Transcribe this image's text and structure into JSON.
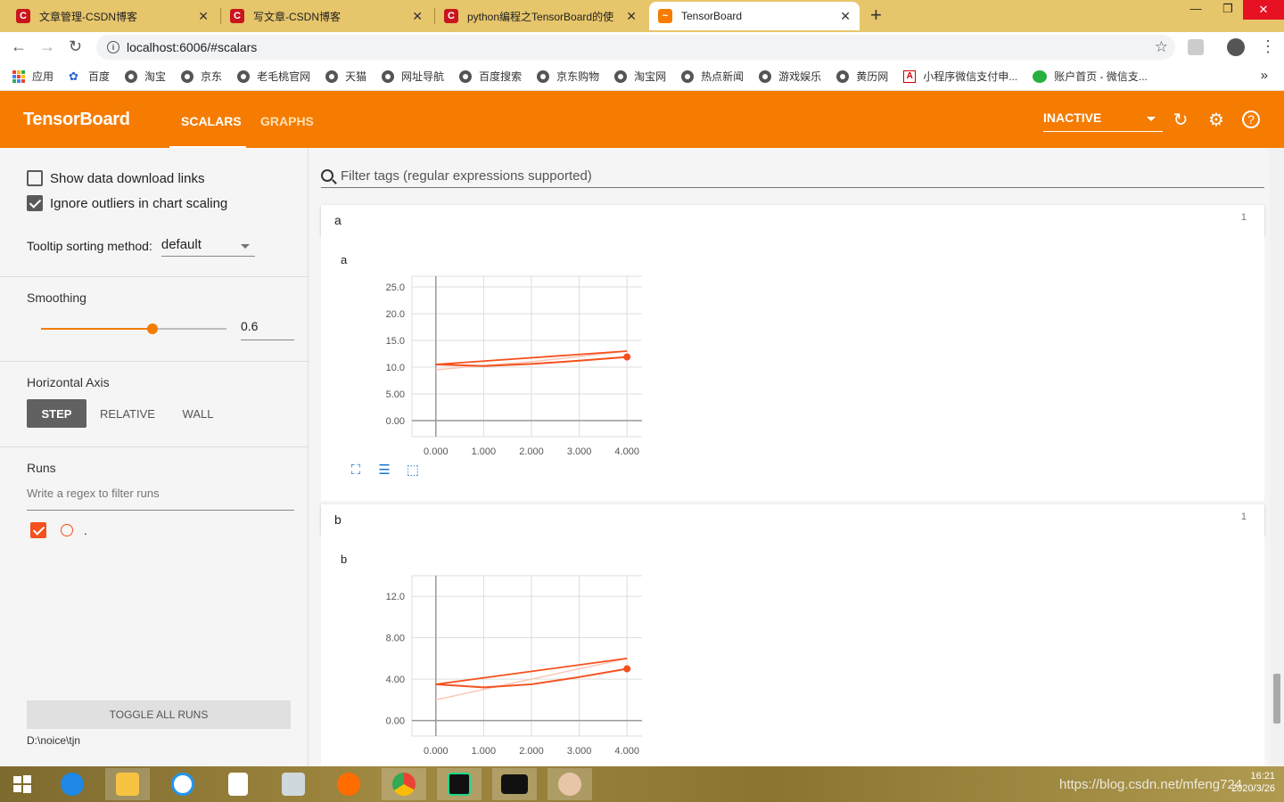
{
  "browser": {
    "tabs": [
      {
        "title": "文章管理-CSDN博客",
        "favicon": "csdn"
      },
      {
        "title": "写文章-CSDN博客",
        "favicon": "csdn"
      },
      {
        "title": "python编程之TensorBoard的使",
        "favicon": "csdn"
      },
      {
        "title": "TensorBoard",
        "favicon": "tensorboard"
      }
    ],
    "url": "localhost:6006/#scalars",
    "bookmarks": [
      "应用",
      "百度",
      "淘宝",
      "京东",
      "老毛桃官网",
      "天猫",
      "网址导航",
      "百度搜索",
      "京东购物",
      "淘宝网",
      "热点新闻",
      "游戏娱乐",
      "黄历网",
      "小程序微信支付申...",
      "账户首页 - 微信支..."
    ]
  },
  "header": {
    "title": "TensorBoard",
    "tabs": [
      "SCALARS",
      "GRAPHS"
    ],
    "status": "INACTIVE",
    "accent": "#f57c00"
  },
  "sidebar": {
    "show_download": "Show data download links",
    "ignore_outliers": "Ignore outliers in chart scaling",
    "tooltip_label": "Tooltip sorting method:",
    "tooltip_value": "default",
    "smoothing_label": "Smoothing",
    "smoothing_value": "0.6",
    "smoothing_fraction": 0.6,
    "haxis_label": "Horizontal Axis",
    "haxis_options": [
      "STEP",
      "RELATIVE",
      "WALL"
    ],
    "runs_label": "Runs",
    "runs_placeholder": "Write a regex to filter runs",
    "run_name": ".",
    "toggle_all": "TOGGLE ALL RUNS",
    "logdir": "D:\\noice\\tjn"
  },
  "main": {
    "filter_placeholder": "Filter tags (regular expressions supported)",
    "cards": [
      {
        "tag": "a",
        "count": "1",
        "chart_title": "a"
      },
      {
        "tag": "b",
        "count": "1",
        "chart_title": "b"
      }
    ]
  },
  "chart_data": [
    {
      "type": "line",
      "title": "a",
      "x_ticks": [
        "0.000",
        "1.000",
        "2.000",
        "3.000",
        "4.000"
      ],
      "y_ticks": [
        "0.00",
        "5.00",
        "10.0",
        "15.0",
        "20.0",
        "25.0"
      ],
      "ylim": [
        -3,
        27
      ],
      "xlim": [
        -0.5,
        4.5
      ],
      "series": [
        {
          "style": "raw",
          "color": "#f9c4b4",
          "x": [
            0,
            1,
            2,
            3,
            4
          ],
          "y": [
            9.5,
            10.3,
            11.0,
            12.0,
            13.0
          ]
        },
        {
          "style": "smoothed",
          "color": "#f4511e",
          "x": [
            0,
            1,
            2,
            3,
            4
          ],
          "y": [
            10.5,
            10.2,
            10.6,
            11.2,
            11.9
          ]
        },
        {
          "style": "raw-line",
          "color": "#f4511e",
          "x": [
            0,
            4
          ],
          "y": [
            10.5,
            13.0
          ]
        }
      ]
    },
    {
      "type": "line",
      "title": "b",
      "x_ticks": [
        "0.000",
        "1.000",
        "2.000",
        "3.000",
        "4.000"
      ],
      "y_ticks": [
        "0.00",
        "4.00",
        "8.00",
        "12.0"
      ],
      "ylim": [
        -1.5,
        14
      ],
      "xlim": [
        -0.5,
        4.5
      ],
      "series": [
        {
          "style": "raw",
          "color": "#f9c4b4",
          "x": [
            0,
            1,
            2,
            3,
            4
          ],
          "y": [
            2.0,
            3.0,
            4.0,
            5.0,
            6.0
          ]
        },
        {
          "style": "smoothed",
          "color": "#f4511e",
          "x": [
            0,
            1,
            2,
            3,
            4
          ],
          "y": [
            3.5,
            3.2,
            3.5,
            4.2,
            5.0
          ]
        },
        {
          "style": "raw-line",
          "color": "#f4511e",
          "x": [
            0,
            4
          ],
          "y": [
            3.5,
            6.0
          ]
        }
      ]
    }
  ],
  "taskbar": {
    "time": "16:21",
    "date": "2020/3/26",
    "watermark": "https://blog.csdn.net/mfeng724"
  }
}
